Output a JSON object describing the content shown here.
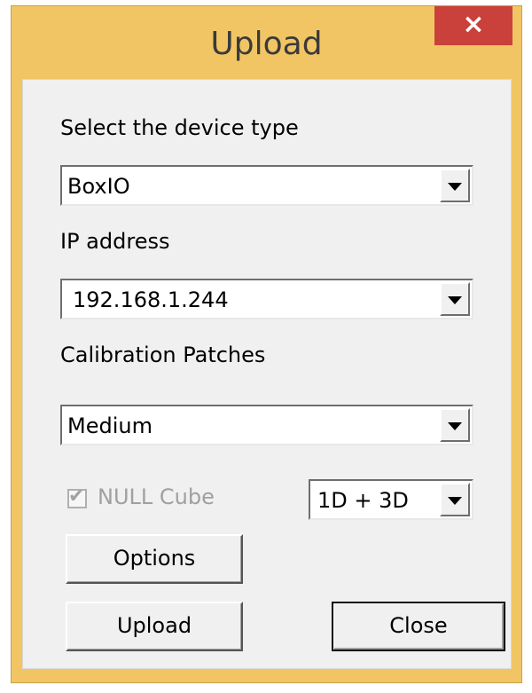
{
  "window": {
    "title": "Upload",
    "close_glyph": "×"
  },
  "device_type": {
    "label": "Select the device type",
    "value": "BoxIO"
  },
  "ip_address": {
    "label": "IP address",
    "value": "192.168.1.244"
  },
  "calibration": {
    "label": "Calibration Patches",
    "value": "Medium"
  },
  "null_cube": {
    "label": "NULL Cube",
    "checked": true,
    "enabled": false,
    "check_glyph": "✔"
  },
  "lut_type": {
    "value": "1D + 3D"
  },
  "buttons": {
    "options": "Options",
    "upload": "Upload",
    "close": "Close"
  },
  "colors": {
    "titlebar": "#f2c564",
    "close_button": "#c9413a",
    "client": "#f0f0f0"
  }
}
